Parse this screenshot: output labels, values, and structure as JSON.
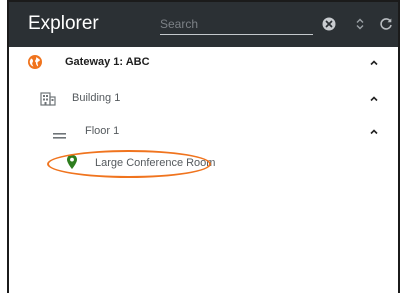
{
  "header": {
    "title": "Explorer",
    "search_placeholder": "Search",
    "search_value": ""
  },
  "colors": {
    "header_bg": "#2b3034",
    "accent_orange": "#f0741e",
    "location_green": "#2e7d1e"
  },
  "icons": {
    "clear": "close-circle-icon",
    "sort": "sort-icon",
    "refresh": "refresh-icon",
    "gateway": "globe-icon",
    "building": "building-icon",
    "floor": "floor-lines-icon",
    "room": "location-pin-icon",
    "expand": "chevron-up-icon"
  },
  "tree": {
    "gateway": {
      "label": "Gateway 1: ABC",
      "expanded": true
    },
    "building": {
      "label": "Building 1",
      "expanded": true
    },
    "floor": {
      "label": "Floor 1",
      "expanded": true
    },
    "room": {
      "label": "Large Conference Room",
      "highlighted": true
    }
  }
}
